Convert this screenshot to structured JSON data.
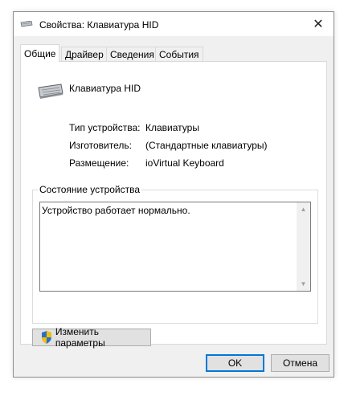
{
  "window": {
    "title": "Свойства: Клавиатура HID"
  },
  "tabs": [
    {
      "label": "Общие",
      "active": true
    },
    {
      "label": "Драйвер",
      "active": false
    },
    {
      "label": "Сведения",
      "active": false
    },
    {
      "label": "События",
      "active": false
    }
  ],
  "device": {
    "name": "Клавиатура HID",
    "icon": "keyboard-icon",
    "properties": [
      {
        "label": "Тип устройства:",
        "value": "Клавиатуры"
      },
      {
        "label": "Изготовитель:",
        "value": "(Стандартные клавиатуры)"
      },
      {
        "label": "Размещение:",
        "value": "ioVirtual Keyboard"
      }
    ]
  },
  "status": {
    "legend": "Состояние устройства",
    "text": "Устройство работает нормально."
  },
  "buttons": {
    "change": "Изменить параметры",
    "ok": "OK",
    "cancel": "Отмена"
  },
  "colors": {
    "accent": "#0078d7",
    "dialog_bg": "#f0f0f0"
  }
}
